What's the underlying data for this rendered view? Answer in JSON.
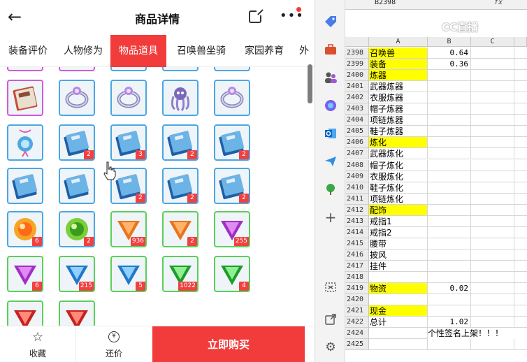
{
  "header": {
    "back_icon": "back-arrow-icon",
    "title": "商品详情",
    "share_icon": "share-icon",
    "more_icon": "more-icon"
  },
  "tabs": [
    {
      "label": "装备评价",
      "active": false
    },
    {
      "label": "人物修为",
      "active": false
    },
    {
      "label": "物品道具",
      "active": true
    },
    {
      "label": "召唤兽坐骑",
      "active": false
    },
    {
      "label": "家园养育",
      "active": false
    },
    {
      "label": "外",
      "active": false
    }
  ],
  "items": [
    {
      "kind": "book-red",
      "border": "purple",
      "count": ""
    },
    {
      "kind": "ring-silver",
      "border": "blue",
      "count": ""
    },
    {
      "kind": "ring-silver",
      "border": "blue",
      "count": ""
    },
    {
      "kind": "octopus-charm",
      "border": "blue",
      "count": ""
    },
    {
      "kind": "ring-silver",
      "border": "blue",
      "count": ""
    },
    {
      "kind": "amulet-blue",
      "border": "blue",
      "count": ""
    },
    {
      "kind": "book-blue",
      "border": "blue",
      "count": "2"
    },
    {
      "kind": "book-blue",
      "border": "blue",
      "count": "3"
    },
    {
      "kind": "book-blue",
      "border": "blue",
      "count": "2"
    },
    {
      "kind": "book-blue",
      "border": "blue",
      "count": "2"
    },
    {
      "kind": "book-blue",
      "border": "blue",
      "count": ""
    },
    {
      "kind": "book-blue",
      "border": "blue",
      "count": ""
    },
    {
      "kind": "book-blue",
      "border": "blue",
      "count": "2"
    },
    {
      "kind": "book-blue",
      "border": "blue",
      "count": "2"
    },
    {
      "kind": "book-blue",
      "border": "blue",
      "count": "2"
    },
    {
      "kind": "orb-fire",
      "border": "blue",
      "count": "6"
    },
    {
      "kind": "orb-green",
      "border": "blue",
      "count": "2"
    },
    {
      "kind": "gem-orange",
      "border": "green",
      "count": "936"
    },
    {
      "kind": "gem-orange",
      "border": "green",
      "count": "2"
    },
    {
      "kind": "gem-purple",
      "border": "green",
      "count": "255"
    },
    {
      "kind": "gem-purple",
      "border": "green",
      "count": "6"
    },
    {
      "kind": "gem-blue",
      "border": "green",
      "count": "215"
    },
    {
      "kind": "gem-blue",
      "border": "green",
      "count": "5"
    },
    {
      "kind": "gem-green",
      "border": "green",
      "count": "1022"
    },
    {
      "kind": "gem-green",
      "border": "green",
      "count": "4"
    },
    {
      "kind": "gem-red",
      "border": "green",
      "count": ""
    },
    {
      "kind": "gem-red",
      "border": "green",
      "count": ""
    }
  ],
  "footer": {
    "favorite_label": "收藏",
    "bargain_label": "还价",
    "bargain_icon_text": "¥",
    "buy_label": "立即购买"
  },
  "sidebar_icons": [
    "tag-icon",
    "briefcase-icon",
    "people-icon",
    "copilot-icon",
    "outlook-icon",
    "send-icon",
    "tree-icon",
    "plus-icon",
    "screenshot-icon",
    "open-external-icon",
    "settings-icon"
  ],
  "sheet": {
    "cell_ref": "B2398",
    "fx_label": "fx",
    "watermark": "CC直播",
    "columns": [
      "A",
      "B",
      "C"
    ],
    "rows": [
      {
        "num": "2398",
        "a": "召唤兽",
        "b": "0.64",
        "yellow": true
      },
      {
        "num": "2399",
        "a": "装备",
        "b": "0.36",
        "yellow": true
      },
      {
        "num": "2400",
        "a": "炼器",
        "b": "",
        "yellow": true
      },
      {
        "num": "2401",
        "a": "武器炼器",
        "b": "",
        "yellow": false
      },
      {
        "num": "2402",
        "a": "衣服炼器",
        "b": "",
        "yellow": false
      },
      {
        "num": "2403",
        "a": "帽子炼器",
        "b": "",
        "yellow": false
      },
      {
        "num": "2404",
        "a": "项链炼器",
        "b": "",
        "yellow": false
      },
      {
        "num": "2405",
        "a": "鞋子炼器",
        "b": "",
        "yellow": false
      },
      {
        "num": "2406",
        "a": "炼化",
        "b": "",
        "yellow": true
      },
      {
        "num": "2407",
        "a": "武器炼化",
        "b": "",
        "yellow": false
      },
      {
        "num": "2408",
        "a": "帽子炼化",
        "b": "",
        "yellow": false
      },
      {
        "num": "2409",
        "a": "衣服炼化",
        "b": "",
        "yellow": false
      },
      {
        "num": "2410",
        "a": "鞋子炼化",
        "b": "",
        "yellow": false
      },
      {
        "num": "2411",
        "a": "项链炼化",
        "b": "",
        "yellow": false
      },
      {
        "num": "2412",
        "a": "配饰",
        "b": "",
        "yellow": true
      },
      {
        "num": "2413",
        "a": "戒指1",
        "b": "",
        "yellow": false
      },
      {
        "num": "2414",
        "a": "戒指2",
        "b": "",
        "yellow": false
      },
      {
        "num": "2415",
        "a": "腰带",
        "b": "",
        "yellow": false
      },
      {
        "num": "2416",
        "a": "披风",
        "b": "",
        "yellow": false
      },
      {
        "num": "2417",
        "a": "挂件",
        "b": "",
        "yellow": false
      },
      {
        "num": "2418",
        "a": "",
        "b": "",
        "yellow": false
      },
      {
        "num": "2419",
        "a": "物资",
        "b": "0.02",
        "yellow": true
      },
      {
        "num": "2420",
        "a": "",
        "b": "",
        "yellow": false
      },
      {
        "num": "2421",
        "a": "现金",
        "b": "",
        "yellow": true
      },
      {
        "num": "2422",
        "a": "总计",
        "b": "1.02",
        "yellow": false
      },
      {
        "num": "2424",
        "a": "",
        "b": "",
        "yellow": false,
        "marquee": "个性签名上架！！！"
      },
      {
        "num": "2425",
        "a": "",
        "b": "",
        "yellow": false
      }
    ]
  }
}
